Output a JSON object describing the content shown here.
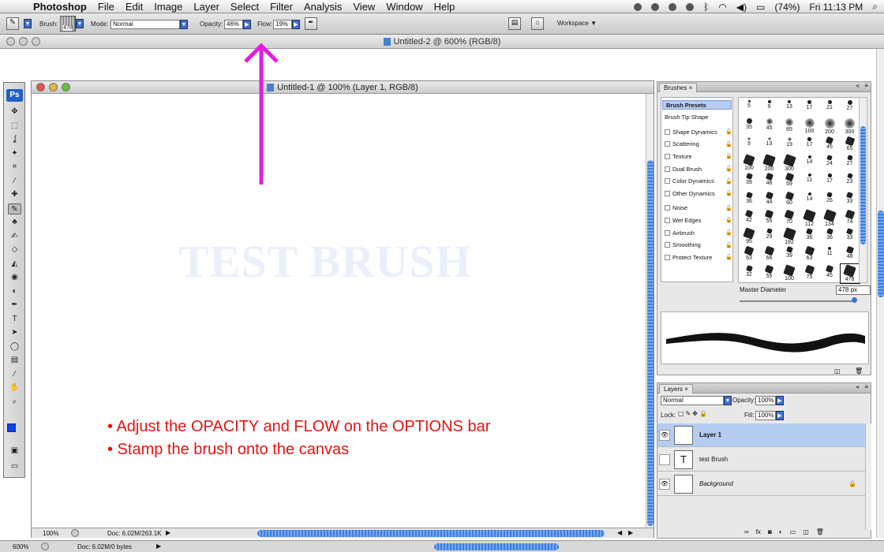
{
  "menubar": {
    "app_name": "Photoshop",
    "menus": [
      "File",
      "Edit",
      "Image",
      "Layer",
      "Select",
      "Filter",
      "Analysis",
      "View",
      "Window",
      "Help"
    ],
    "battery": "(74%)",
    "clock": "Fri 11:13 PM"
  },
  "options_bar": {
    "brush_label": "Brush:",
    "brush_size": "478",
    "mode_label": "Mode:",
    "mode_value": "Normal",
    "opacity_label": "Opacity:",
    "opacity_value": "46%",
    "flow_label": "Flow:",
    "flow_value": "19%",
    "workspace_label": "Workspace"
  },
  "background_window": {
    "title": "Untitled-2 @ 600% (RGB/8)",
    "zoom": "600%",
    "doc_info": "Doc: 6.02M/0 bytes"
  },
  "document": {
    "title": "Untitled-1 @ 100% (Layer 1, RGB/8)",
    "watermark_text": "TEST BRUSH",
    "instructions": [
      "• Adjust the OPACITY and FLOW on the OPTIONS bar",
      "• Stamp the brush onto the canvas"
    ],
    "zoom": "100%",
    "doc_info": "Doc: 6.02M/263.1K"
  },
  "colors": {
    "arrow": "#e01ce0",
    "instruction_text": "#e81212",
    "foreground": "#0a42e8",
    "background": "#ffffff",
    "selection": "#b4cdf0"
  },
  "brushes_panel": {
    "tab": "Brushes",
    "options": [
      {
        "label": "Brush Presets",
        "checkbox": false,
        "header": true
      },
      {
        "label": "Brush Tip Shape",
        "checkbox": false,
        "header": false
      },
      {
        "label": "Shape Dynamics",
        "checkbox": true
      },
      {
        "label": "Scattering",
        "checkbox": true
      },
      {
        "label": "Texture",
        "checkbox": true
      },
      {
        "label": "Dual Brush",
        "checkbox": true
      },
      {
        "label": "Color Dynamics",
        "checkbox": true
      },
      {
        "label": "Other Dynamics",
        "checkbox": true
      },
      {
        "label": "Noise",
        "checkbox": true
      },
      {
        "label": "Wet Edges",
        "checkbox": true
      },
      {
        "label": "Airbrush",
        "checkbox": true
      },
      {
        "label": "Smoothing",
        "checkbox": true
      },
      {
        "label": "Protect Texture",
        "checkbox": true
      }
    ],
    "presets": [
      "5",
      "9",
      "13",
      "17",
      "21",
      "27",
      "35",
      "45",
      "65",
      "100",
      "200",
      "300",
      "9",
      "13",
      "19",
      "17",
      "45",
      "65",
      "100",
      "200",
      "300",
      "14",
      "24",
      "27",
      "39",
      "46",
      "59",
      "11",
      "17",
      "23",
      "36",
      "44",
      "60",
      "14",
      "26",
      "33",
      "42",
      "55",
      "70",
      "112",
      "134",
      "74",
      "95",
      "29",
      "192",
      "36",
      "36",
      "33",
      "63",
      "66",
      "39",
      "63",
      "11",
      "48",
      "32",
      "55",
      "100",
      "75",
      "45",
      "478"
    ],
    "master_diameter_label": "Master Diameter",
    "master_diameter_value": "478 px"
  },
  "layers_panel": {
    "tab": "Layers",
    "blend_mode": "Normal",
    "opacity_label": "Opacity:",
    "opacity_value": "100%",
    "lock_label": "Lock:",
    "fill_label": "Fill:",
    "fill_value": "100%",
    "layers": [
      {
        "name": "Layer 1",
        "type": "pixel",
        "visible": true,
        "selected": true
      },
      {
        "name": "test Brush",
        "type": "text",
        "visible": false,
        "selected": false
      },
      {
        "name": "Background",
        "type": "background",
        "visible": true,
        "selected": false
      }
    ]
  },
  "toolbox": {
    "logo": "Ps",
    "tools": [
      "move-tool",
      "marquee-tool",
      "lasso-tool",
      "magic-wand-tool",
      "crop-tool",
      "slice-tool",
      "healing-tool",
      "brush-tool",
      "stamp-tool",
      "history-brush-tool",
      "eraser-tool",
      "bucket-tool",
      "blur-tool",
      "dodge-tool",
      "pen-tool",
      "type-tool",
      "path-select-tool",
      "shape-tool",
      "notes-tool",
      "eyedropper-tool",
      "hand-tool",
      "zoom-tool"
    ]
  }
}
